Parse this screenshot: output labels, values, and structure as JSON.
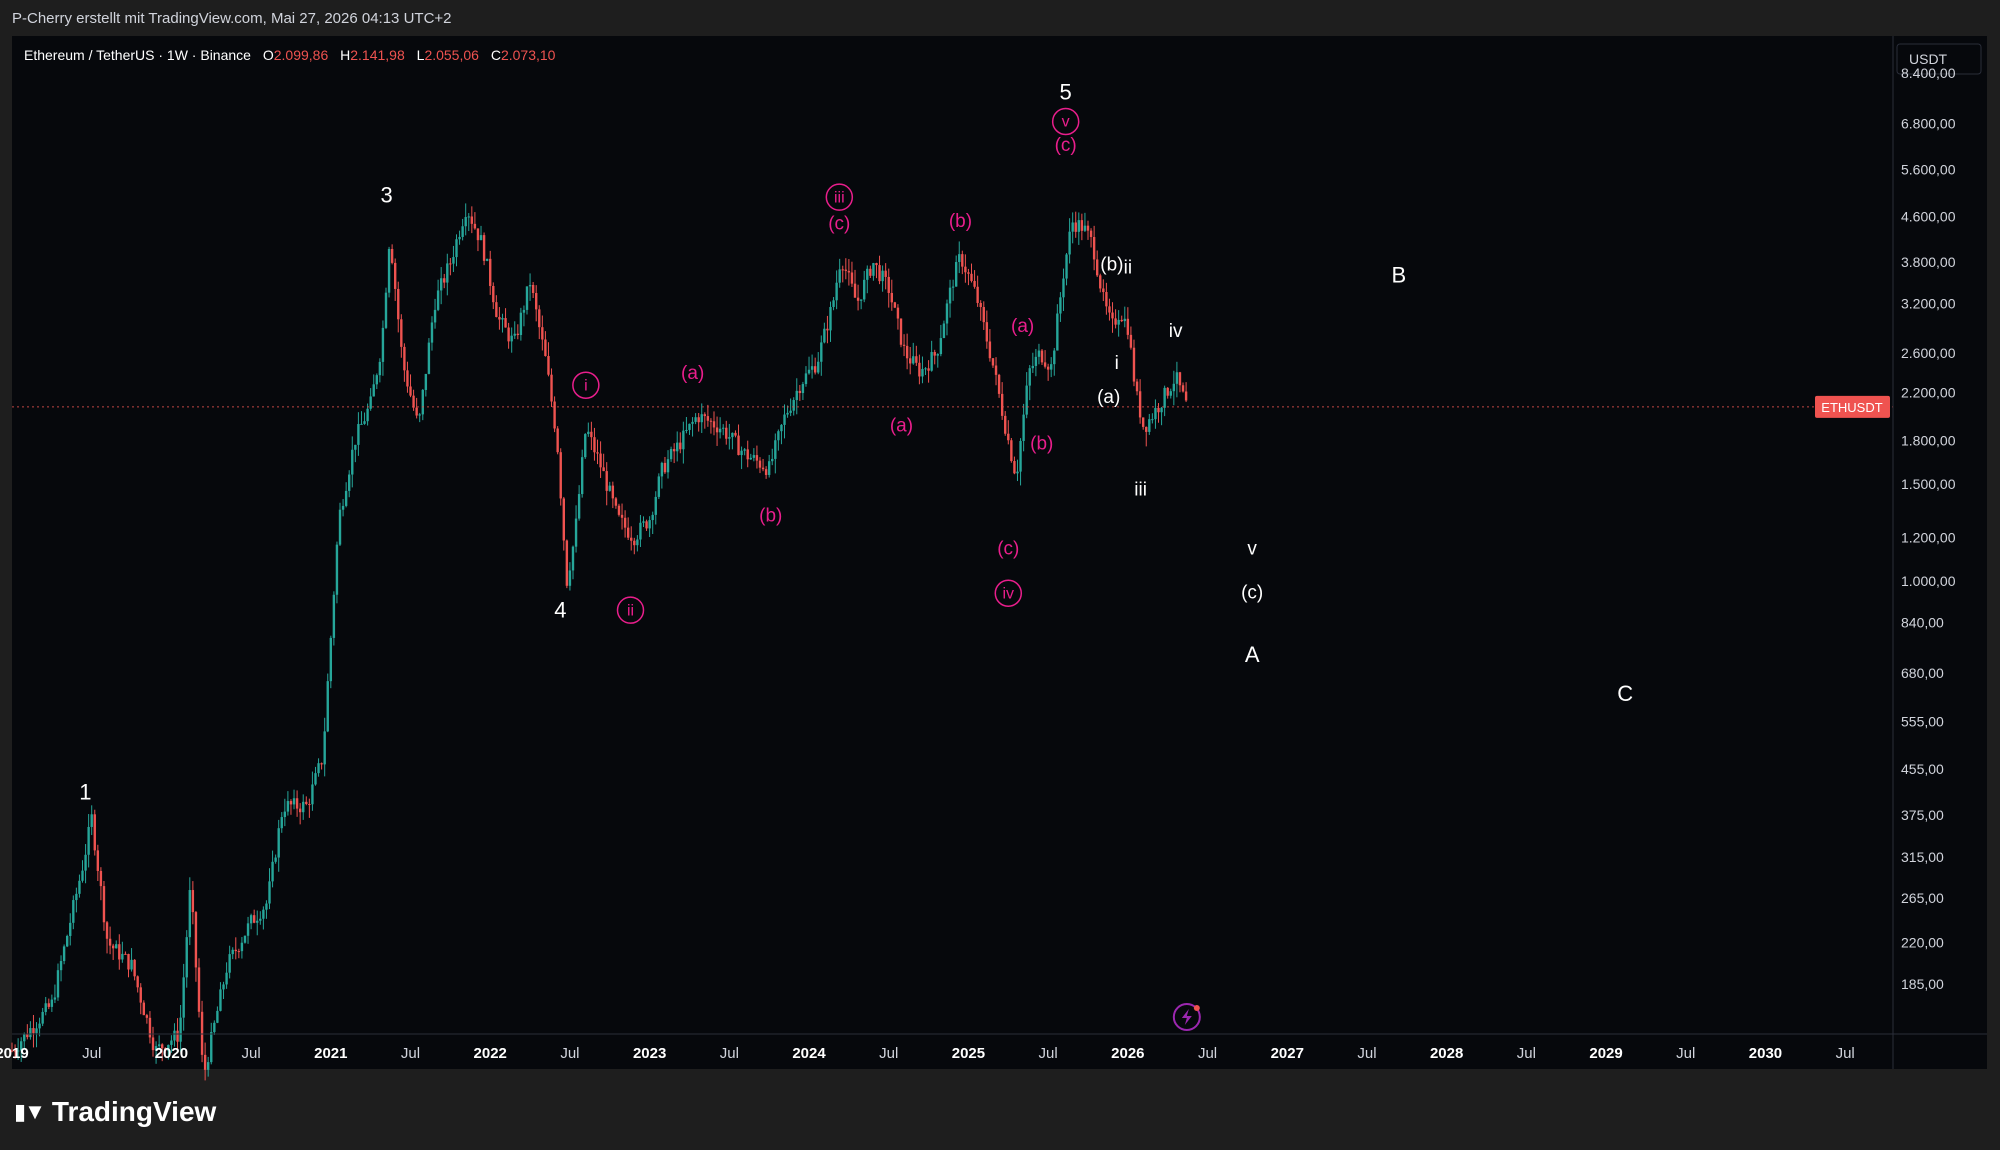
{
  "header": {
    "credit": "P-Cherry erstellt mit TradingView.com, Mai 27, 2026 04:13 UTC+2"
  },
  "legend": {
    "symbol": "Ethereum / TetherUS · 1W · Binance",
    "open_label": "O",
    "open": "2.099,86",
    "high_label": "H",
    "high": "2.141,98",
    "low_label": "L",
    "low": "2.055,06",
    "close_label": "C",
    "close": "2.073,10"
  },
  "footer": {
    "brand": "TradingView"
  },
  "chart_data": {
    "type": "candlestick",
    "symbol": "ETHUSDT",
    "interval": "1W",
    "exchange": "Binance",
    "currency": "USDT",
    "y_scale": "log",
    "ylim": [
      150,
      9800
    ],
    "xlim": [
      2019.0,
      2030.8
    ],
    "last_price": {
      "value": 2073.1,
      "symbol_label": "ETHUSDT",
      "price_label": "2.073,10"
    },
    "y_ticks": [
      {
        "v": 8400,
        "l": "8.400,00"
      },
      {
        "v": 6800,
        "l": "6.800,00"
      },
      {
        "v": 5600,
        "l": "5.600,00"
      },
      {
        "v": 4600,
        "l": "4.600,00"
      },
      {
        "v": 3800,
        "l": "3.800,00"
      },
      {
        "v": 3200,
        "l": "3.200,00"
      },
      {
        "v": 2600,
        "l": "2.600,00"
      },
      {
        "v": 2200,
        "l": "2.200,00"
      },
      {
        "v": 1800,
        "l": "1.800,00"
      },
      {
        "v": 1500,
        "l": "1.500,00"
      },
      {
        "v": 1200,
        "l": "1.200,00"
      },
      {
        "v": 1000,
        "l": "1.000,00"
      },
      {
        "v": 840,
        "l": "840,00"
      },
      {
        "v": 680,
        "l": "680,00"
      },
      {
        "v": 555,
        "l": "555,00"
      },
      {
        "v": 455,
        "l": "455,00"
      },
      {
        "v": 375,
        "l": "375,00"
      },
      {
        "v": 315,
        "l": "315,00"
      },
      {
        "v": 265,
        "l": "265,00"
      },
      {
        "v": 220,
        "l": "220,00"
      },
      {
        "v": 185,
        "l": "185,00"
      }
    ],
    "x_ticks": [
      {
        "t": 2019.0,
        "l": "2019",
        "b": true
      },
      {
        "t": 2019.5,
        "l": "Jul",
        "b": false
      },
      {
        "t": 2020.0,
        "l": "2020",
        "b": true
      },
      {
        "t": 2020.5,
        "l": "Jul",
        "b": false
      },
      {
        "t": 2021.0,
        "l": "2021",
        "b": true
      },
      {
        "t": 2021.5,
        "l": "Jul",
        "b": false
      },
      {
        "t": 2022.0,
        "l": "2022",
        "b": true
      },
      {
        "t": 2022.5,
        "l": "Jul",
        "b": false
      },
      {
        "t": 2023.0,
        "l": "2023",
        "b": true
      },
      {
        "t": 2023.5,
        "l": "Jul",
        "b": false
      },
      {
        "t": 2024.0,
        "l": "2024",
        "b": true
      },
      {
        "t": 2024.5,
        "l": "Jul",
        "b": false
      },
      {
        "t": 2025.0,
        "l": "2025",
        "b": true
      },
      {
        "t": 2025.5,
        "l": "Jul",
        "b": false
      },
      {
        "t": 2026.0,
        "l": "2026",
        "b": true
      },
      {
        "t": 2026.5,
        "l": "Jul",
        "b": false
      },
      {
        "t": 2027.0,
        "l": "2027",
        "b": true
      },
      {
        "t": 2027.5,
        "l": "Jul",
        "b": false
      },
      {
        "t": 2028.0,
        "l": "2028",
        "b": true
      },
      {
        "t": 2028.5,
        "l": "Jul",
        "b": false
      },
      {
        "t": 2029.0,
        "l": "2029",
        "b": true
      },
      {
        "t": 2029.5,
        "l": "Jul",
        "b": false
      },
      {
        "t": 2030.0,
        "l": "2030",
        "b": true
      },
      {
        "t": 2030.5,
        "l": "Jul",
        "b": false
      }
    ],
    "price_path": [
      [
        2019.0,
        140
      ],
      [
        2019.25,
        170
      ],
      [
        2019.45,
        310
      ],
      [
        2019.5,
        370
      ],
      [
        2019.6,
        220
      ],
      [
        2019.75,
        200
      ],
      [
        2019.9,
        140
      ],
      [
        2020.05,
        150
      ],
      [
        2020.12,
        280
      ],
      [
        2020.2,
        125
      ],
      [
        2020.35,
        200
      ],
      [
        2020.5,
        240
      ],
      [
        2020.6,
        260
      ],
      [
        2020.7,
        390
      ],
      [
        2020.85,
        390
      ],
      [
        2020.95,
        480
      ],
      [
        2021.05,
        1300
      ],
      [
        2021.15,
        1800
      ],
      [
        2021.25,
        2100
      ],
      [
        2021.32,
        2700
      ],
      [
        2021.37,
        4300
      ],
      [
        2021.45,
        2500
      ],
      [
        2021.55,
        1900
      ],
      [
        2021.65,
        3200
      ],
      [
        2021.75,
        3800
      ],
      [
        2021.85,
        4800
      ],
      [
        2021.95,
        4100
      ],
      [
        2022.05,
        3000
      ],
      [
        2022.15,
        2700
      ],
      [
        2022.25,
        3500
      ],
      [
        2022.35,
        2500
      ],
      [
        2022.42,
        1800
      ],
      [
        2022.48,
        1000
      ],
      [
        2022.53,
        1200
      ],
      [
        2022.6,
        1900
      ],
      [
        2022.7,
        1600
      ],
      [
        2022.8,
        1300
      ],
      [
        2022.9,
        1200
      ],
      [
        2023.0,
        1300
      ],
      [
        2023.08,
        1600
      ],
      [
        2023.2,
        1800
      ],
      [
        2023.3,
        2000
      ],
      [
        2023.45,
        1900
      ],
      [
        2023.6,
        1700
      ],
      [
        2023.75,
        1600
      ],
      [
        2023.85,
        2000
      ],
      [
        2023.95,
        2300
      ],
      [
        2024.05,
        2500
      ],
      [
        2024.15,
        3200
      ],
      [
        2024.2,
        3900
      ],
      [
        2024.3,
        3200
      ],
      [
        2024.4,
        3800
      ],
      [
        2024.5,
        3400
      ],
      [
        2024.6,
        2600
      ],
      [
        2024.7,
        2400
      ],
      [
        2024.8,
        2600
      ],
      [
        2024.9,
        3500
      ],
      [
        2024.95,
        3900
      ],
      [
        2025.05,
        3300
      ],
      [
        2025.15,
        2500
      ],
      [
        2025.25,
        1800
      ],
      [
        2025.3,
        1550
      ],
      [
        2025.38,
        2400
      ],
      [
        2025.45,
        2600
      ],
      [
        2025.52,
        2450
      ],
      [
        2025.6,
        3700
      ],
      [
        2025.65,
        4500
      ],
      [
        2025.72,
        4400
      ],
      [
        2025.78,
        4100
      ],
      [
        2025.85,
        3200
      ],
      [
        2025.9,
        2900
      ],
      [
        2025.95,
        3100
      ],
      [
        2026.0,
        2900
      ],
      [
        2026.05,
        2200
      ],
      [
        2026.1,
        1900
      ],
      [
        2026.2,
        2100
      ],
      [
        2026.3,
        2350
      ],
      [
        2026.37,
        2073
      ]
    ],
    "annotations": {
      "primary": [
        {
          "t": 2019.46,
          "v": 410,
          "label": "1"
        },
        {
          "t": 2021.35,
          "v": 5000,
          "label": "3"
        },
        {
          "t": 2022.44,
          "v": 880,
          "label": "4"
        },
        {
          "t": 2025.61,
          "v": 7700,
          "label": "5"
        },
        {
          "t": 2026.78,
          "v": 730,
          "label": "A"
        },
        {
          "t": 2027.7,
          "v": 3580,
          "label": "B"
        },
        {
          "t": 2029.12,
          "v": 620,
          "label": "C"
        }
      ],
      "circled": [
        {
          "t": 2022.6,
          "v": 2270,
          "label": "i"
        },
        {
          "t": 2022.88,
          "v": 885,
          "label": "ii"
        },
        {
          "t": 2024.19,
          "v": 4990,
          "label": "iii"
        },
        {
          "t": 2025.25,
          "v": 950,
          "label": "iv"
        },
        {
          "t": 2025.61,
          "v": 6850,
          "label": "v"
        }
      ],
      "magenta": [
        {
          "t": 2023.27,
          "v": 2380,
          "label": "(a)"
        },
        {
          "t": 2023.76,
          "v": 1310,
          "label": "(b)"
        },
        {
          "t": 2024.19,
          "v": 4450,
          "label": "(c)"
        },
        {
          "t": 2024.58,
          "v": 1910,
          "label": "(a)"
        },
        {
          "t": 2024.95,
          "v": 4500,
          "label": "(b)"
        },
        {
          "t": 2025.25,
          "v": 1140,
          "label": "(c)"
        },
        {
          "t": 2025.34,
          "v": 2900,
          "label": "(a)"
        },
        {
          "t": 2025.46,
          "v": 1770,
          "label": "(b)"
        },
        {
          "t": 2025.61,
          "v": 6180,
          "label": "(c)"
        }
      ],
      "white_minor": [
        {
          "t": 2025.88,
          "v": 2150,
          "label": "(a)"
        },
        {
          "t": 2025.9,
          "v": 3750,
          "label": "(b)"
        },
        {
          "t": 2025.93,
          "v": 2480,
          "label": "i"
        },
        {
          "t": 2026.0,
          "v": 3700,
          "label": "ii"
        },
        {
          "t": 2026.08,
          "v": 1460,
          "label": "iii"
        },
        {
          "t": 2026.3,
          "v": 2840,
          "label": "iv"
        },
        {
          "t": 2026.78,
          "v": 1140,
          "label": "v"
        },
        {
          "t": 2026.78,
          "v": 950,
          "label": "(c)"
        }
      ]
    },
    "colors": {
      "up": "#26a69a",
      "down": "#ef5350",
      "magenta": "#e91e8c",
      "background": "#06080c"
    }
  }
}
